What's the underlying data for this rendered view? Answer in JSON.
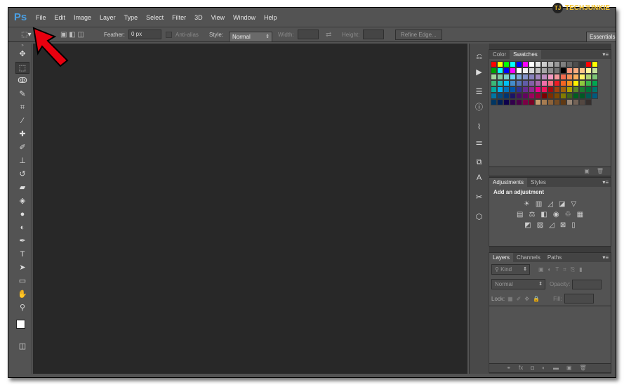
{
  "app": {
    "logo": "Ps"
  },
  "menu": [
    "File",
    "Edit",
    "Image",
    "Layer",
    "Type",
    "Select",
    "Filter",
    "3D",
    "View",
    "Window",
    "Help"
  ],
  "options": {
    "feather_label": "Feather:",
    "feather_value": "0 px",
    "antialias_label": "Anti-alias",
    "style_label": "Style:",
    "style_value": "Normal",
    "width_label": "Width:",
    "height_label": "Height:",
    "refine_label": "Refine Edge...",
    "workspace": "Essentials"
  },
  "tools": [
    "marquee-tool",
    "lasso-tool",
    "quick-selection-tool",
    "crop-tool",
    "eyedropper-tool",
    "healing-brush-tool",
    "brush-tool",
    "clone-stamp-tool",
    "history-brush-tool",
    "eraser-tool",
    "paint-bucket-tool",
    "blur-tool",
    "dodge-tool",
    "pen-tool",
    "type-tool",
    "path-selection-tool",
    "rectangle-tool",
    "hand-tool",
    "zoom-tool"
  ],
  "color_panel": {
    "tabs": [
      "Color",
      "Swatches"
    ]
  },
  "swatch_colors": [
    "#ff0000",
    "#ffff00",
    "#00ff00",
    "#00ffff",
    "#0000ff",
    "#ff00ff",
    "#ffffff",
    "#e6e6e6",
    "#cccccc",
    "#b3b3b3",
    "#999999",
    "#808080",
    "#666666",
    "#4d4d4d",
    "#333333",
    "#ff0000",
    "#ffff00",
    "#00a000",
    "#00ffff",
    "#0000ff",
    "#ff00ff",
    "#ffffff",
    "#f0f0f0",
    "#d9d9d9",
    "#bfbfbf",
    "#a6a6a6",
    "#8c8c8c",
    "#737373",
    "#000000",
    "#f7977a",
    "#f9ad81",
    "#fdc68a",
    "#fff79a",
    "#c4df9b",
    "#a3d39c",
    "#82ca9d",
    "#7bcdc8",
    "#6ecff6",
    "#7ea7d8",
    "#8493ca",
    "#8882be",
    "#a187be",
    "#bc8dbf",
    "#f49ac2",
    "#f6989d",
    "#f26c4f",
    "#f68e55",
    "#fbaf5c",
    "#fff467",
    "#acd372",
    "#7cc576",
    "#3bb878",
    "#1abbb4",
    "#00bff3",
    "#438ccb",
    "#5574b9",
    "#605ca8",
    "#855fa8",
    "#a763a8",
    "#f06eaa",
    "#f26d7d",
    "#ed1c24",
    "#f26522",
    "#f7941d",
    "#fff200",
    "#8dc73f",
    "#39b54a",
    "#00a651",
    "#00a99d",
    "#00aeef",
    "#0072bc",
    "#0054a6",
    "#2e3192",
    "#662d91",
    "#92278f",
    "#ec008c",
    "#ed145b",
    "#9e0b0f",
    "#a0410d",
    "#a3620a",
    "#aba000",
    "#598527",
    "#197b30",
    "#007236",
    "#00746b",
    "#0076a3",
    "#004a80",
    "#003471",
    "#1b1464",
    "#440e62",
    "#630460",
    "#9e005d",
    "#9e0039",
    "#790000",
    "#7b2e00",
    "#7d4900",
    "#827b00",
    "#406618",
    "#005e20",
    "#005826",
    "#005952",
    "#005b7f",
    "#003663",
    "#002157",
    "#0d004c",
    "#32004b",
    "#4b0049",
    "#7b0046",
    "#7a0026",
    "#c69c6d",
    "#a67c52",
    "#8c6239",
    "#754c24",
    "#603913",
    "#998675",
    "#736357",
    "#534741",
    "#362f2d"
  ],
  "adjustments": {
    "tabs": [
      "Adjustments",
      "Styles"
    ],
    "heading": "Add an adjustment"
  },
  "layers": {
    "tabs": [
      "Layers",
      "Channels",
      "Paths"
    ],
    "kind": "Kind",
    "blend": "Normal",
    "opacity_label": "Opacity:",
    "lock_label": "Lock:",
    "fill_label": "Fill:"
  },
  "watermark": {
    "logo": "TJ",
    "text": "TECHJUNKIE"
  },
  "colors": {
    "accent_ps": "#4a9fe3",
    "arrow": "#e8000f",
    "watermark": "#f4c22b"
  }
}
